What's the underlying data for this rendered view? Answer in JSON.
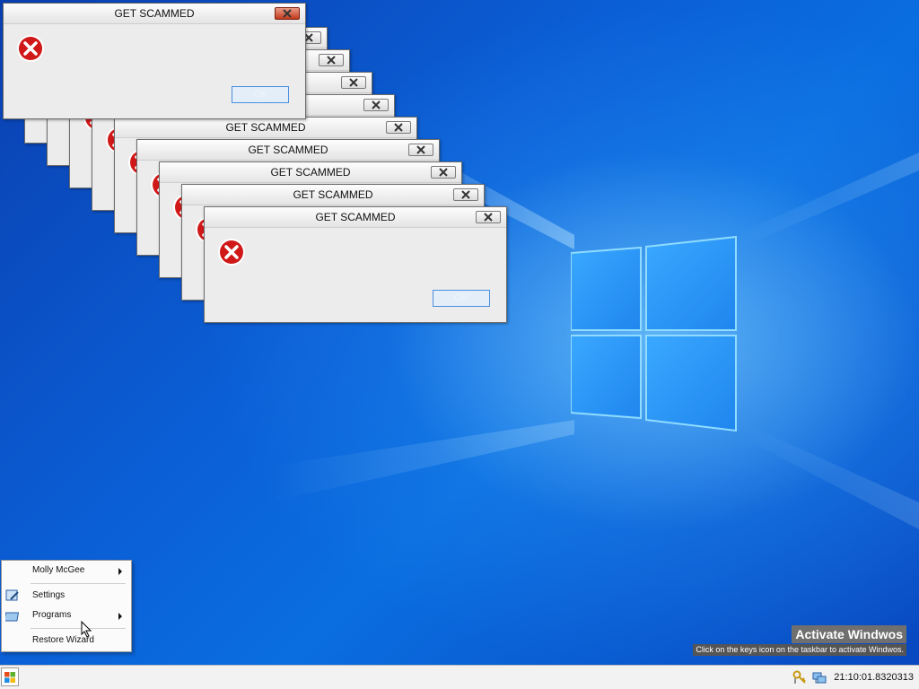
{
  "dialogs": [
    {
      "title": "GET SCAMMED",
      "message": "",
      "ok": "OK"
    },
    {
      "title": "GET SCAMMED",
      "message": "",
      "ok": "OK"
    },
    {
      "title": "GET SCAMMED",
      "message": "",
      "ok": "OK"
    },
    {
      "title": "GET SCAMMED",
      "message": "",
      "ok": "OK"
    },
    {
      "title": "GET SCAMMED",
      "message": "",
      "ok": "OK"
    },
    {
      "title": "GET SCAMMED",
      "message": "",
      "ok": "OK"
    },
    {
      "title": "GET SCAMMED",
      "message": "",
      "ok": "OK"
    },
    {
      "title": "GET SCAMMED",
      "message": "",
      "ok": "OK"
    },
    {
      "title": "GET SCAMMED",
      "message": "",
      "ok": "OK"
    },
    {
      "title": "GET SCAMMED",
      "message": "",
      "ok": "OK"
    }
  ],
  "start_menu": {
    "user": "Molly McGee",
    "settings": "Settings",
    "programs": "Programs",
    "restore": "Restore Wizard"
  },
  "activation": {
    "title": "Activate Windwos",
    "subtitle": "Click on the keys icon on the taskbar to activate Windwos."
  },
  "taskbar": {
    "clock": "21:10:01.8320313",
    "tray_icons": [
      "keys-icon",
      "network-icon"
    ],
    "start_icon": "windows-logo-icon"
  },
  "colors": {
    "desktop": "#0b5fd6",
    "error_red": "#d01818",
    "logo_glow": "#7fd4ff"
  }
}
